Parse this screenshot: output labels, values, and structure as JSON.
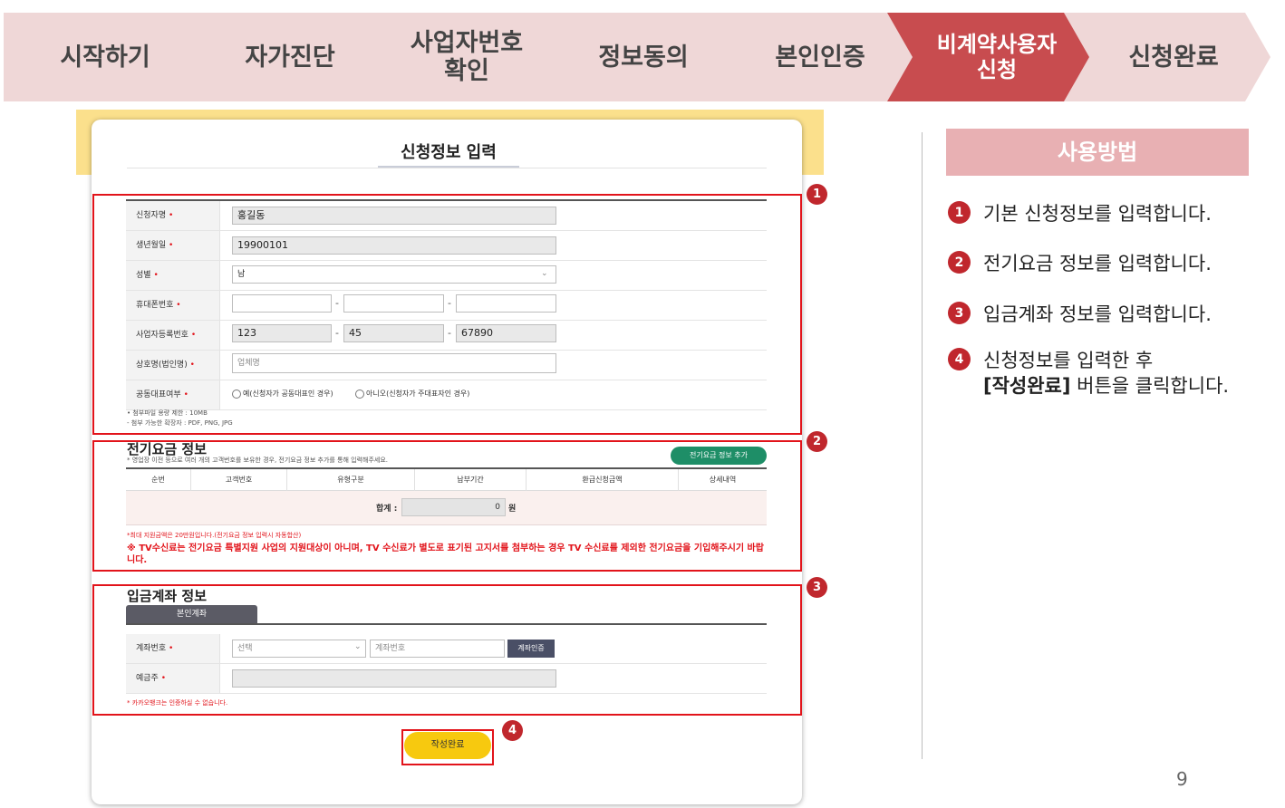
{
  "steps": [
    {
      "label": "시작하기"
    },
    {
      "label": "자가진단"
    },
    {
      "label": "사업자번호\n확인"
    },
    {
      "label": "정보동의"
    },
    {
      "label": "본인인증"
    },
    {
      "label": "비계약사용자\n신청"
    },
    {
      "label": "신청완료"
    }
  ],
  "form": {
    "title": "신청정보 입력",
    "fields": {
      "name": {
        "label": "신청자명",
        "value": "홍길동"
      },
      "birth": {
        "label": "생년월일",
        "value": "19900101"
      },
      "gender": {
        "label": "성별",
        "value": "남"
      },
      "phone": {
        "label": "휴대폰번호",
        "value1": "",
        "value2": "",
        "value3": ""
      },
      "bizno": {
        "label": "사업자등록번호",
        "part1": "123",
        "part2": "45",
        "part3": "67890"
      },
      "company": {
        "label": "상호명(법인명)",
        "placeholder": "업체명"
      },
      "corep": {
        "label": "공동대표여부",
        "opt_yes": "예(신청자가 공동대표인 경우)",
        "opt_no": "아니오(신청자가 주대표자인 경우)"
      }
    },
    "required_mark": "•",
    "dash": "-",
    "attach_note1": "• 첨부파일 용량 제한 : 10MB",
    "attach_note2": "- 첨부 가능한 확장자 : PDF, PNG, JPG",
    "electric": {
      "title": "전기요금 정보",
      "subtitle": "* 영업장 이전 등으로 여러 개의 고객번호를 보유한 경우, 전기요금 정보 추가를 통해 입력해주세요.",
      "add_button": "전기요금 정보 추가",
      "columns": [
        "순번",
        "고객번호",
        "유형구분",
        "납부기간",
        "환급신청금액",
        "상세내역"
      ],
      "sum_label": "합계 :",
      "sum_value": "0",
      "sum_unit": "원",
      "note1": "*최대 지원금액은 20만원입니다.(전기요금 정보 입력시 자동합산)",
      "note2": "※ TV수신료는 전기요금 특별지원 사업의 지원대상이 아니며, TV 수신료가 별도로 표기된 고지서를 첨부하는 경우 TV 수신료를 제외한 전기요금을 기입해주시기 바랍니다."
    },
    "account": {
      "title": "입금계좌 정보",
      "tab": "본인계좌",
      "acc_label": "계좌번호",
      "bank_placeholder": "선택",
      "acc_placeholder": "계좌번호",
      "verify_button": "계좌인증",
      "holder_label": "예금주",
      "holder_value": "",
      "note": "* 카카오뱅크는 인증하실 수 없습니다."
    },
    "submit": "작성완료"
  },
  "badges": [
    "1",
    "2",
    "3",
    "4"
  ],
  "howto": {
    "title": "사용방법",
    "items": [
      {
        "num": "1",
        "text": "기본 신청정보를 입력합니다."
      },
      {
        "num": "2",
        "text": "전기요금 정보를 입력합니다."
      },
      {
        "num": "3",
        "text": "입금계좌 정보를 입력합니다."
      },
      {
        "num": "4",
        "text": "신청정보를 입력한 후",
        "bold": "[작성완료]",
        "text2": " 버튼을 클릭합니다."
      }
    ]
  },
  "page_number": "9",
  "colors": {
    "accent": "#c84c4f",
    "step_bg": "#efd7d7",
    "highlight_red": "#e2141b",
    "submit_yellow": "#f7c90f",
    "green": "#1e8e67"
  }
}
